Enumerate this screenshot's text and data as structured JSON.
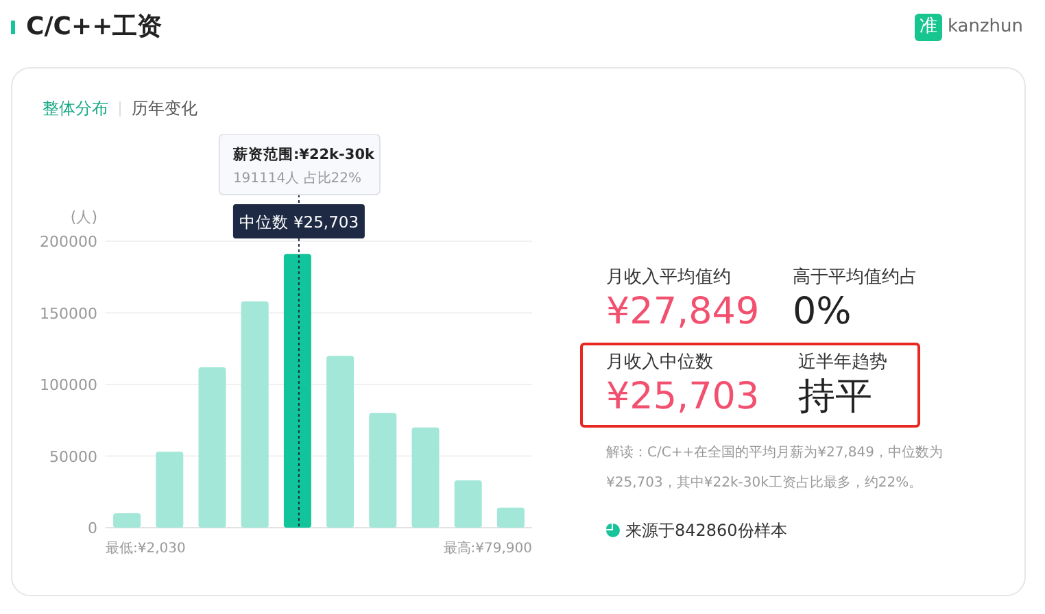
{
  "header": {
    "title": "C/C++工资",
    "brand_mark": "准",
    "brand": "kanzhun"
  },
  "tabs": [
    {
      "label": "整体分布",
      "selected": true
    },
    {
      "label": "历年变化",
      "selected": false
    }
  ],
  "chart": {
    "tooltip": {
      "title": "薪资范围:¥22k-30k",
      "detail": "191114人  占比22%"
    },
    "median_marker": "中位数 ¥25,703",
    "min_label": "最低:¥2,030",
    "max_label": "最高:¥79,900",
    "bars": [
      {
        "selected": false
      },
      {
        "selected": false
      },
      {
        "selected": false
      },
      {
        "selected": false
      },
      {
        "selected": true
      },
      {
        "selected": false
      },
      {
        "selected": false
      },
      {
        "selected": false
      },
      {
        "selected": false
      },
      {
        "selected": false
      }
    ],
    "chart_data": {
      "type": "bar",
      "ylabel": "(人)",
      "grid": true,
      "values": [
        10000,
        53000,
        112000,
        158000,
        191000,
        120000,
        80000,
        70000,
        33000,
        14000
      ],
      "ylim": [
        0,
        200000
      ],
      "yticks": [
        0,
        50000,
        100000,
        150000,
        200000
      ]
    }
  },
  "stats": [
    {
      "highlighted": false,
      "items": [
        {
          "label": "月收入平均值约",
          "value": "¥27,849",
          "kind": "money"
        },
        {
          "label": "高于平均值约占",
          "value": "0%",
          "kind": "plain"
        }
      ]
    },
    {
      "highlighted": true,
      "items": [
        {
          "label": "月收入中位数",
          "value": "¥25,703",
          "kind": "money"
        },
        {
          "label": "近半年趋势",
          "value": "持平",
          "kind": "plain"
        }
      ]
    }
  ],
  "note": "解读：C/C++在全国的平均月薪为¥27,849，中位数为¥25,703，其中¥22k-30k工资占比最多，约22%。",
  "source": "来源于842860份样本"
}
